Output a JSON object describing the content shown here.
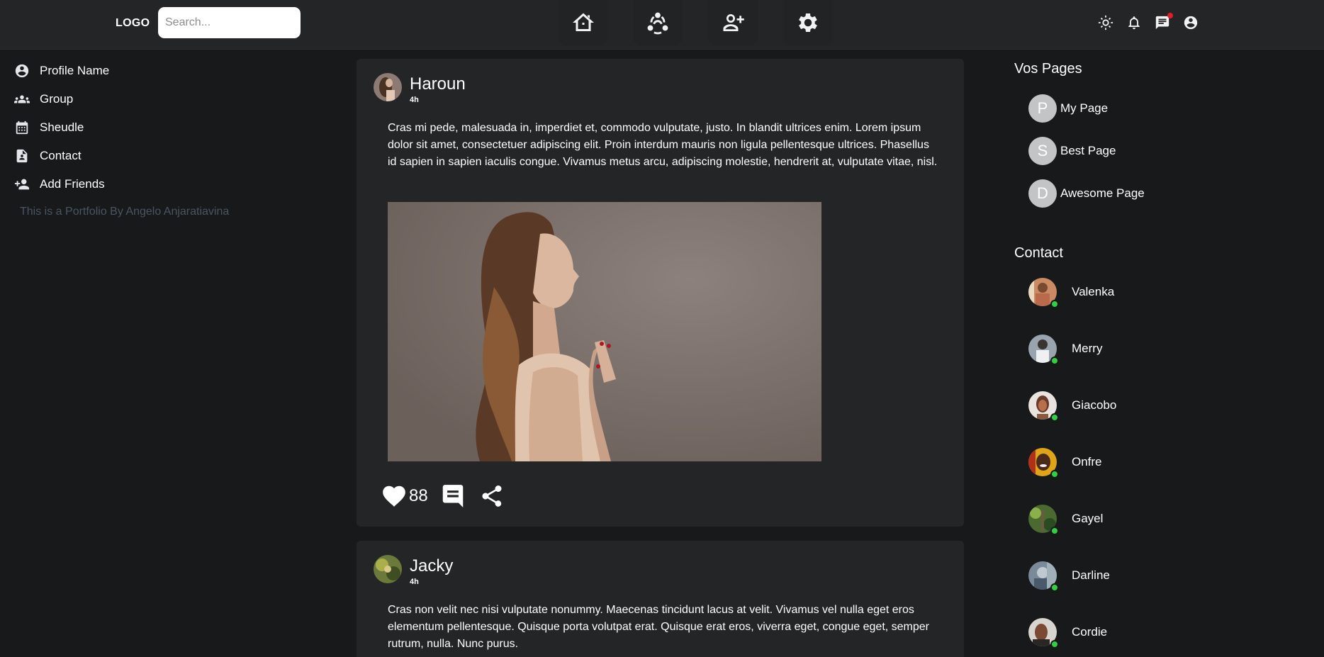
{
  "header": {
    "logo": "LOGO",
    "search_placeholder": "Search...",
    "nav_icons": [
      "home-icon",
      "community-icon",
      "add-friend-icon",
      "settings-icon"
    ],
    "utility_icons": [
      "theme-sun-icon",
      "bell-icon",
      "messages-icon",
      "account-icon"
    ],
    "messages_has_notification": true
  },
  "left_sidebar": {
    "items": [
      {
        "label": "Profile Name",
        "icon": "account-circle-icon"
      },
      {
        "label": "Group",
        "icon": "group-icon"
      },
      {
        "label": "Sheudle",
        "icon": "calendar-icon"
      },
      {
        "label": "Contact",
        "icon": "contact-card-icon"
      },
      {
        "label": "Add Friends",
        "icon": "person-add-icon"
      }
    ],
    "credit": "This is a Portfolio By Angelo Anjaratiavina"
  },
  "feed": {
    "posts": [
      {
        "author": "Haroun",
        "time": "4h",
        "text": "Cras mi pede, malesuada in, imperdiet et, commodo vulputate, justo. In blandit ultrices enim. Lorem ipsum dolor sit amet, consectetuer adipiscing elit. Proin interdum mauris non ligula pellentesque ultrices. Phasellus id sapien in sapien iaculis congue. Vivamus metus arcu, adipiscing molestie, hendrerit at, vulputate vitae, nisl.",
        "likes": "88"
      },
      {
        "author": "Jacky",
        "time": "4h",
        "text": "Cras non velit nec nisi vulputate nonummy. Maecenas tincidunt lacus at velit. Vivamus vel nulla eget eros elementum pellentesque. Quisque porta volutpat erat. Quisque erat eros, viverra eget, congue eget, semper rutrum, nulla. Nunc purus."
      }
    ]
  },
  "right_sidebar": {
    "pages_title": "Vos Pages",
    "pages": [
      {
        "letter": "P",
        "label": "My Page"
      },
      {
        "letter": "S",
        "label": "Best Page"
      },
      {
        "letter": "D",
        "label": "Awesome Page"
      }
    ],
    "contact_title": "Contact",
    "contacts": [
      {
        "name": "Valenka",
        "online": true
      },
      {
        "name": "Merry",
        "online": true
      },
      {
        "name": "Giacobo",
        "online": true
      },
      {
        "name": "Onfre",
        "online": true
      },
      {
        "name": "Gayel",
        "online": true
      },
      {
        "name": "Darline",
        "online": true
      },
      {
        "name": "Cordie",
        "online": true
      }
    ]
  },
  "colors": {
    "background": "#18191a",
    "surface": "#242526",
    "online": "#31d042",
    "notification": "#e41e26",
    "muted_text": "#4a5563"
  }
}
